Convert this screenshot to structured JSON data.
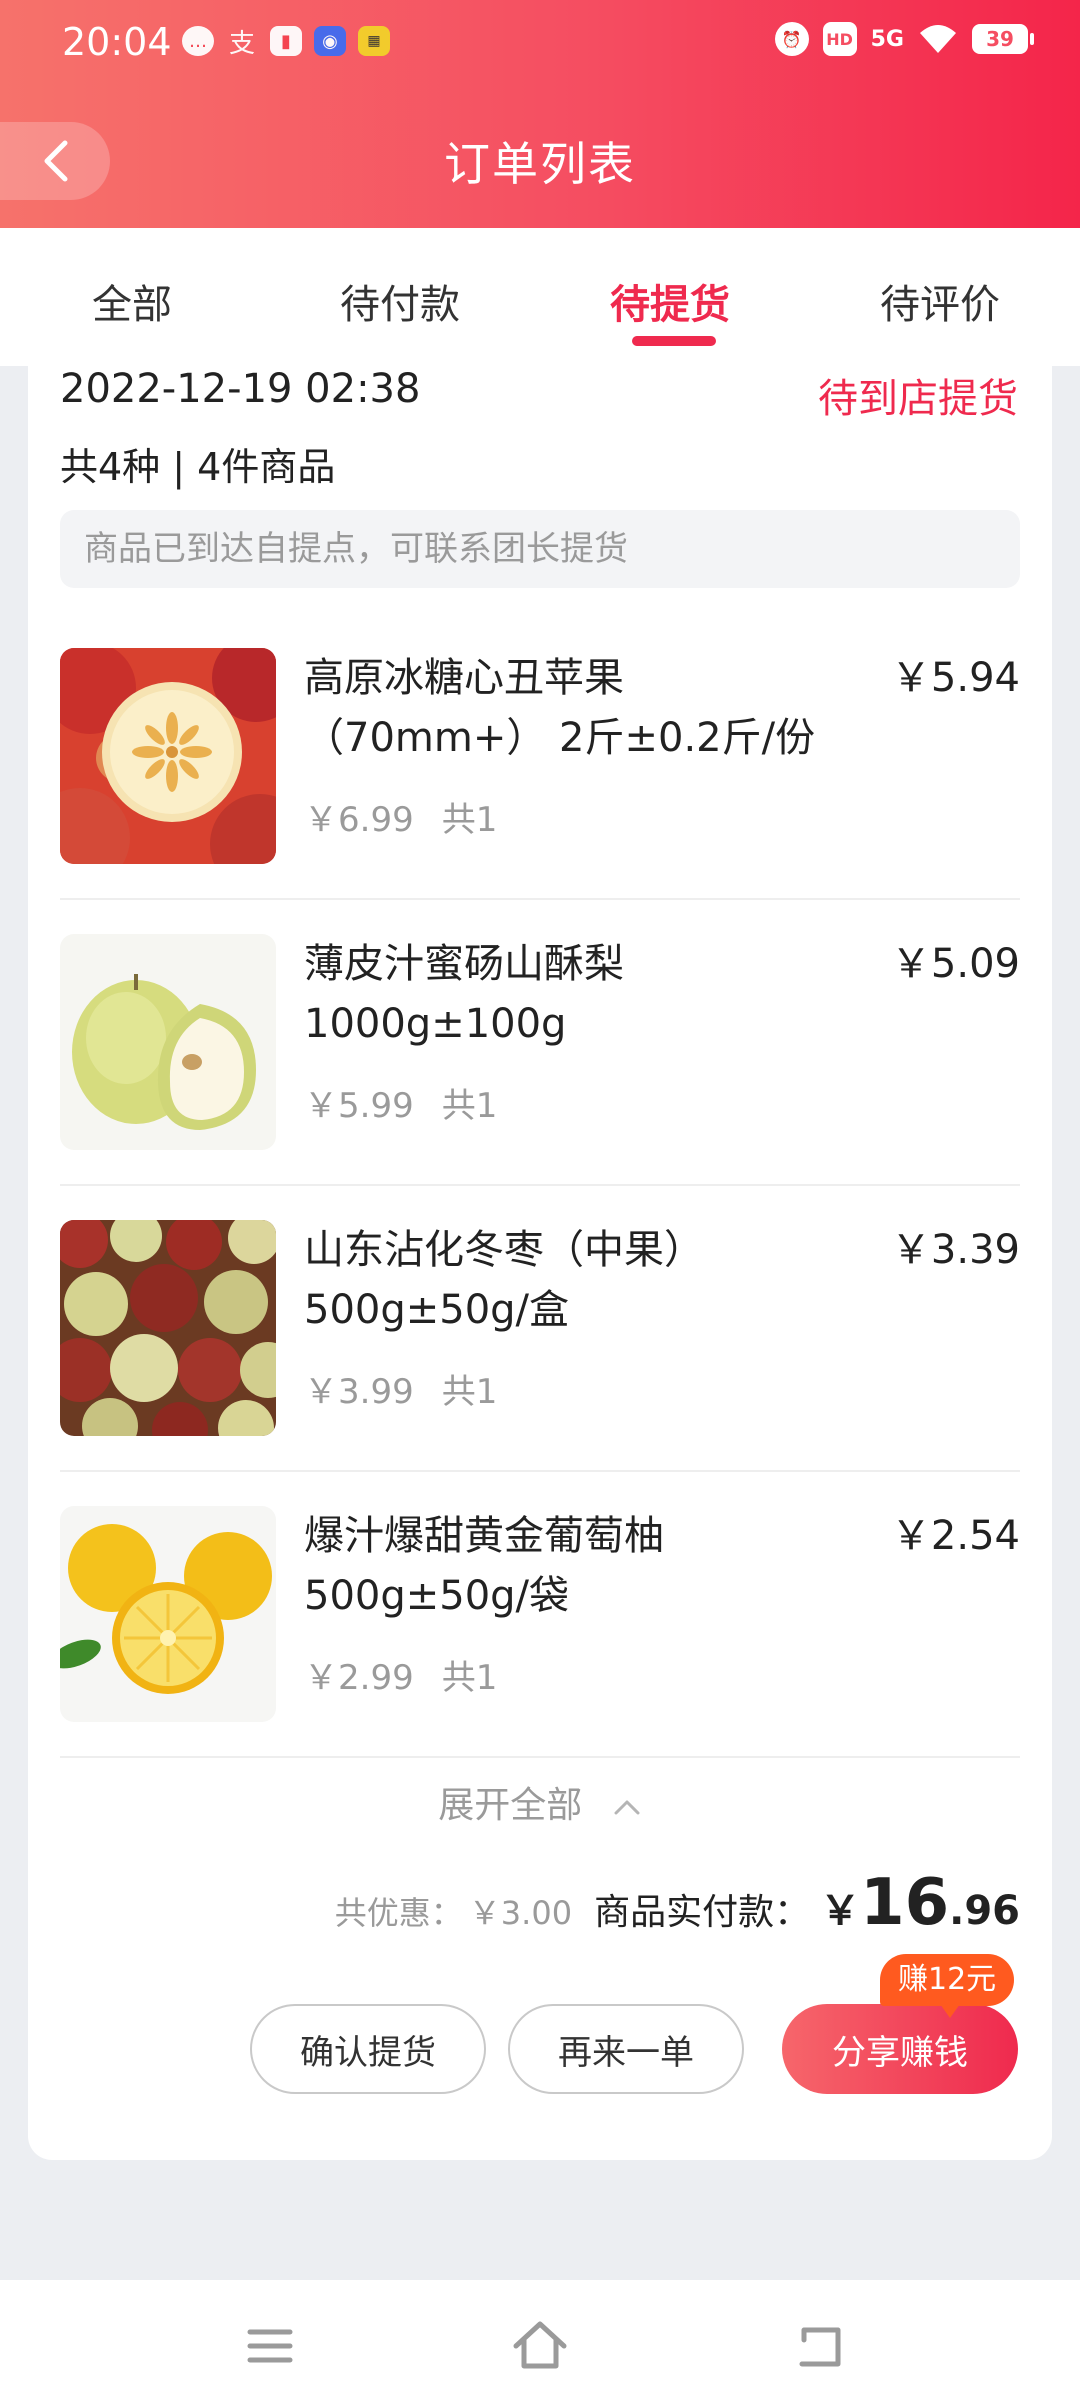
{
  "status_bar": {
    "time": "20:04",
    "notification_icons": [
      "message-icon",
      "alipay-icon",
      "book-icon",
      "qq-icon",
      "app-badge-icon"
    ],
    "signal": "5G",
    "battery": "39"
  },
  "header": {
    "title": "订单列表"
  },
  "tabs": [
    {
      "label": "全部",
      "active": false
    },
    {
      "label": "待付款",
      "active": false
    },
    {
      "label": "待提货",
      "active": true
    },
    {
      "label": "待评价",
      "active": false
    }
  ],
  "order": {
    "date": "2022-12-19 02:38",
    "status": "待到店提货",
    "count_text": "共4种 | 4件商品",
    "notice": "商品已到达自提点，可联系团长提货",
    "items": [
      {
        "name": "高原冰糖心丑苹果（70mm+） 2斤±0.2斤/份",
        "price": "￥5.94",
        "original_price": "￥6.99",
        "quantity": "共1",
        "image": "apple"
      },
      {
        "name": "薄皮汁蜜砀山酥梨1000g±100g",
        "price": "￥5.09",
        "original_price": "￥5.99",
        "quantity": "共1",
        "image": "pear"
      },
      {
        "name": "山东沾化冬枣（中果）500g±50g/盒",
        "price": "￥3.39",
        "original_price": "￥3.99",
        "quantity": "共1",
        "image": "jujube"
      },
      {
        "name": "爆汁爆甜黄金葡萄柚500g±50g/袋",
        "price": "￥2.54",
        "original_price": "￥2.99",
        "quantity": "共1",
        "image": "grapefruit"
      }
    ],
    "expand_label": "展开全部",
    "discount_label": "共优惠：",
    "discount_value": "￥3.00",
    "paid_label": "商品实付款：",
    "paid_symbol": "￥",
    "paid_int": "16",
    "paid_dec": ".96",
    "buttons": {
      "confirm": "确认提货",
      "reorder": "再来一单",
      "share": "分享赚钱"
    },
    "earn_badge": "赚12元"
  },
  "colors": {
    "accent": "#ef2a4e",
    "header_start": "#f6726b",
    "header_end": "#f4254a",
    "badge": "#ff5a1f"
  }
}
